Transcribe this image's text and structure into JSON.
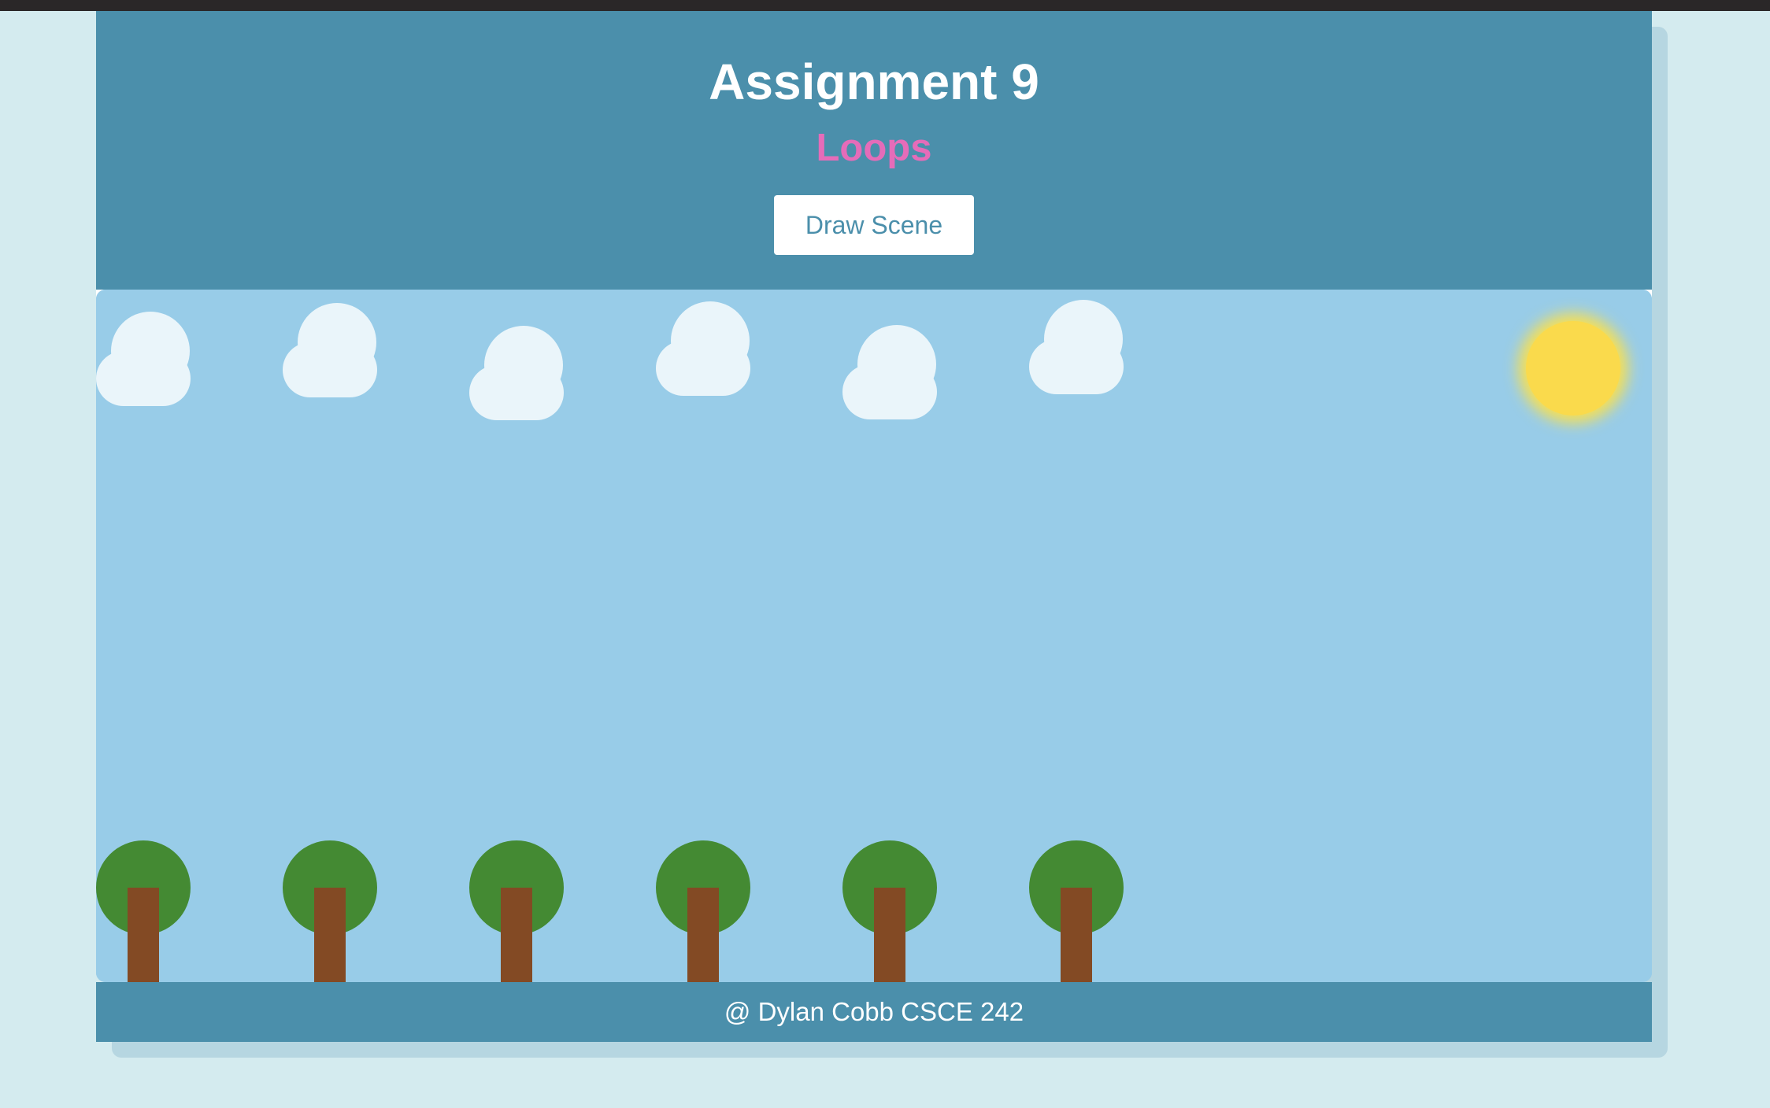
{
  "page": {
    "title": "Assignment 9",
    "subtitle": "Loops",
    "draw_button_label": "Draw Scene",
    "footer_text": "@ Dylan Cobb CSCE 242"
  },
  "scene": {
    "cloud_count": 6,
    "tree_count": 6,
    "colors": {
      "sky": "#98cce8",
      "cloud": "#eaf5fa",
      "sun": "#fada4c",
      "sun_glow": "#f4df56",
      "tree_leaves": "#448a33",
      "tree_trunk": "#834a24",
      "header": "#4b8fab",
      "subtitle": "#e56cb9",
      "page_background": "#d4ebef"
    }
  }
}
